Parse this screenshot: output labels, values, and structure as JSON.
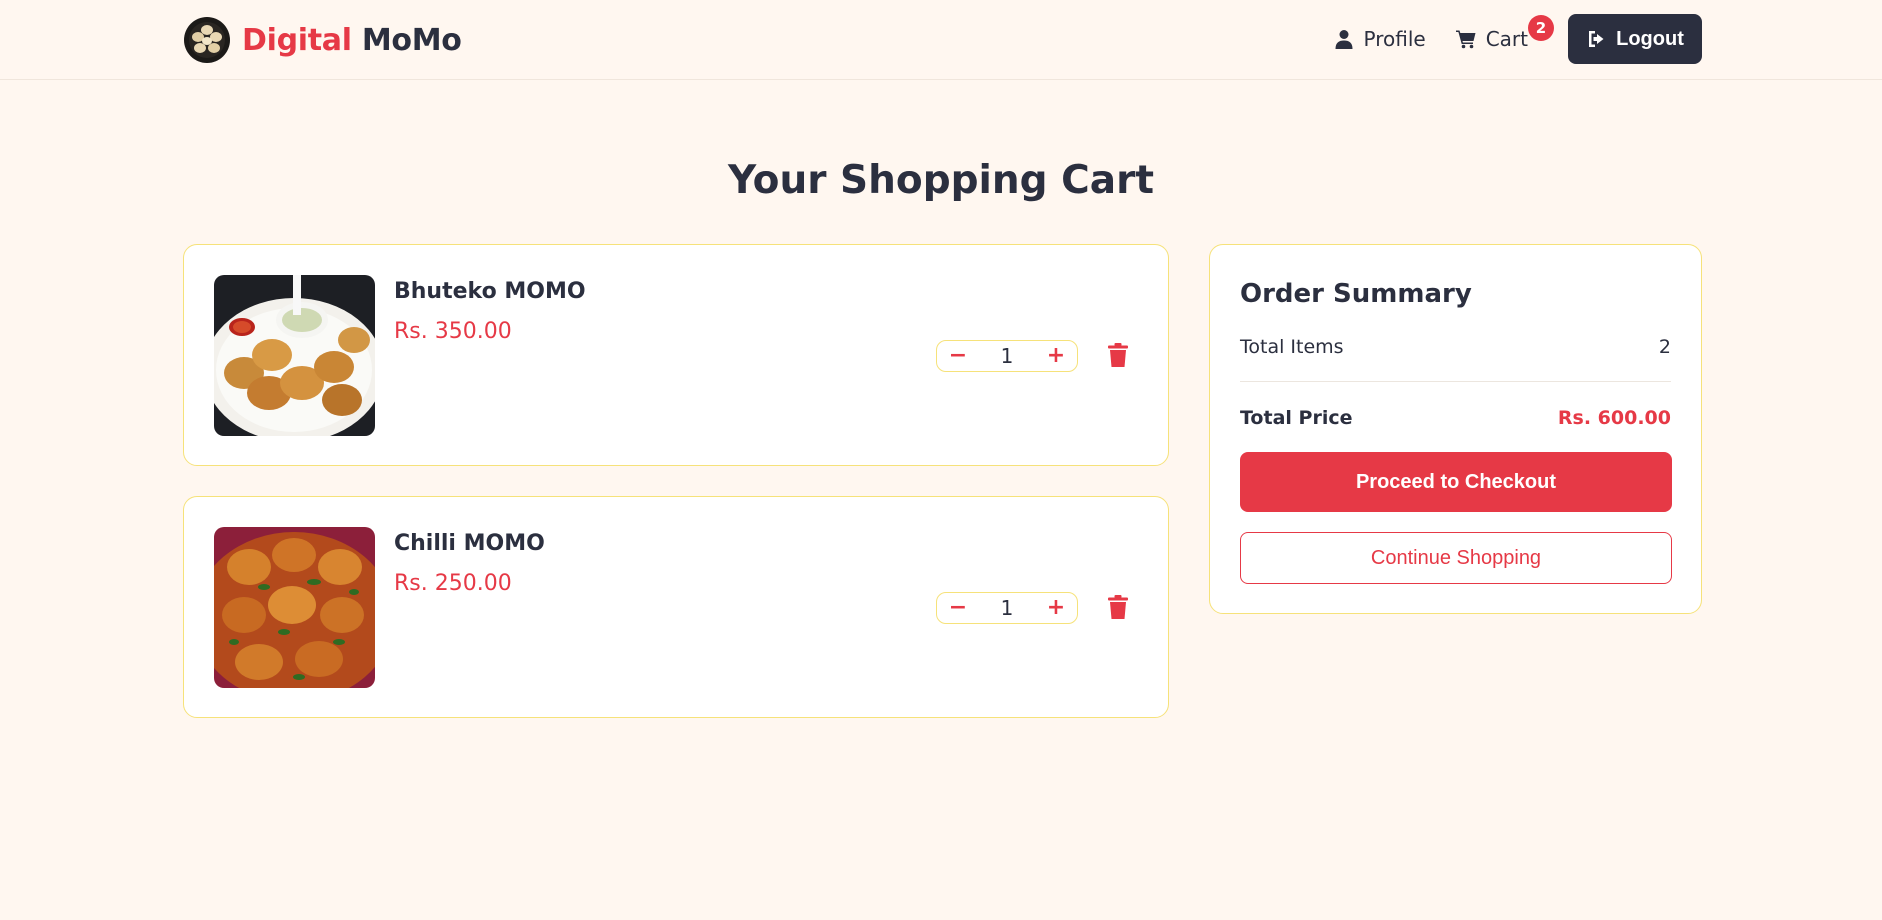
{
  "brand": {
    "name_part1": "Digital",
    "name_part2": "MoMo",
    "logo_icon": "momo-plate-logo"
  },
  "nav": {
    "profile_label": "Profile",
    "profile_icon": "user-icon",
    "cart_label": "Cart",
    "cart_icon": "cart-icon",
    "cart_count": "2",
    "logout_label": "Logout",
    "logout_icon": "sign-out-icon"
  },
  "page": {
    "title": "Your Shopping Cart"
  },
  "cart": {
    "items": [
      {
        "name": "Bhuteko MOMO",
        "price": "Rs. 350.00",
        "quantity": "1",
        "image": "fried-momo-plate-photo"
      },
      {
        "name": "Chilli MOMO",
        "price": "Rs. 250.00",
        "quantity": "1",
        "image": "chilli-momo-photo"
      }
    ]
  },
  "summary": {
    "title": "Order Summary",
    "total_items_label": "Total Items",
    "total_items_value": "2",
    "total_price_label": "Total Price",
    "total_price_value": "Rs. 600.00",
    "checkout_label": "Proceed to Checkout",
    "continue_label": "Continue Shopping"
  },
  "colors": {
    "accent": "#e63946",
    "dark": "#2b2f3f",
    "background": "#fff7f0",
    "card_border": "#f6e27a"
  }
}
